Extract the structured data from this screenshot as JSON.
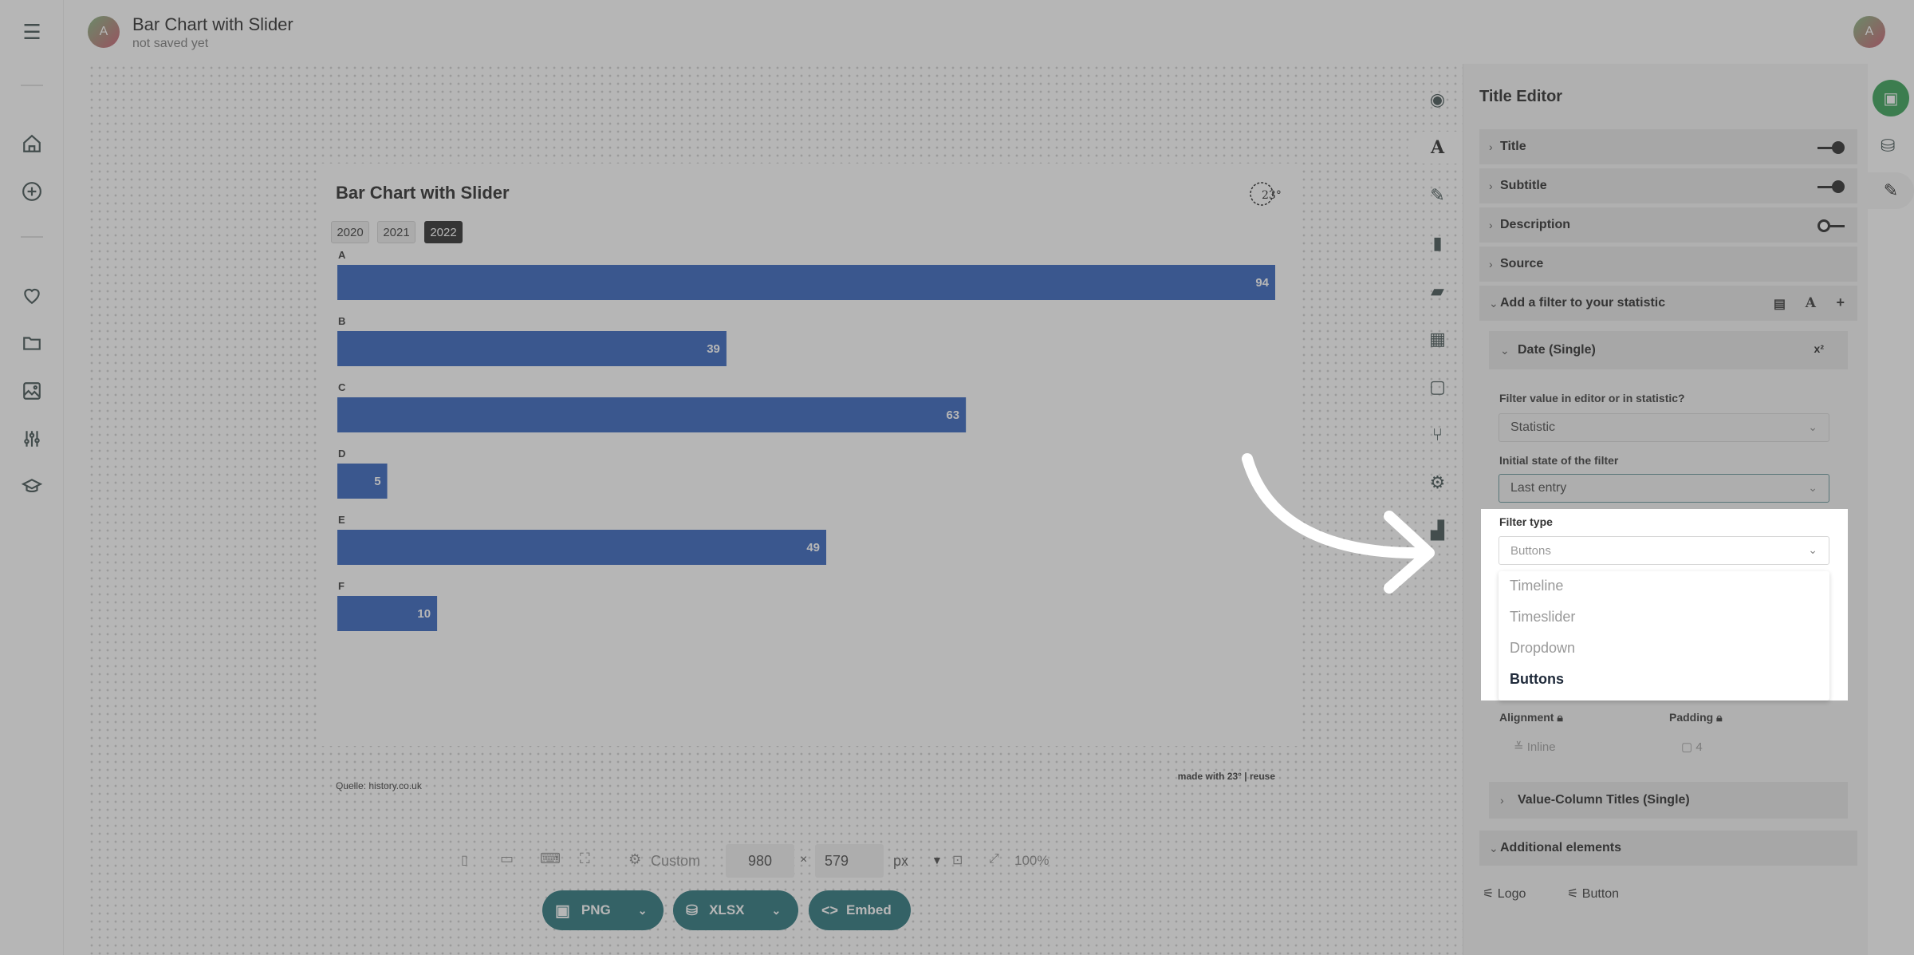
{
  "header": {
    "doc_title": "Bar Chart with Slider",
    "save_status": "not saved yet",
    "avatar_letter": "A",
    "user_avatar_letter": "A"
  },
  "sidebar": {
    "icons": [
      "menu-icon",
      "home-icon",
      "add-circle-icon",
      "heart-icon",
      "folder-icon",
      "image-icon",
      "sliders-icon",
      "graduation-cap-icon"
    ]
  },
  "chart": {
    "title": "Bar Chart with Slider",
    "logo_text": "23°",
    "year_buttons": [
      "2020",
      "2021",
      "2022"
    ],
    "active_year": "2022",
    "source": "Quelle: history.co.uk",
    "footer": "made with 23° | reuse",
    "bar_color": "#2a5cba"
  },
  "chart_data": {
    "type": "bar",
    "orientation": "horizontal",
    "title": "Bar Chart with Slider",
    "categories": [
      "A",
      "B",
      "C",
      "D",
      "E",
      "F"
    ],
    "values": [
      94,
      39,
      63,
      5,
      49,
      10
    ],
    "xlim": [
      0,
      94
    ],
    "grid": false,
    "legend": "none"
  },
  "toolbar": {
    "preset": "Custom",
    "width": "980",
    "times": "×",
    "height": "579",
    "unit": "px",
    "zoom": "100%",
    "png": "PNG",
    "xlsx": "XLSX",
    "embed": "Embed"
  },
  "panel": {
    "title": "Title Editor",
    "rows": {
      "title": "Title",
      "subtitle": "Subtitle",
      "description": "Description",
      "source": "Source",
      "filter": "Add a filter to your statistic",
      "date_single": "Date (Single)",
      "date_superscript": "x²",
      "value_titles": "Value-Column Titles (Single)",
      "additional": "Additional elements"
    },
    "fields": {
      "filter_value_label": "Filter value in editor or in statistic?",
      "filter_value": "Statistic",
      "initial_state_label": "Initial state of the filter",
      "initial_state": "Last entry",
      "filter_type_label": "Filter type",
      "filter_type_placeholder": "Buttons",
      "options": [
        "Timeline",
        "Timeslider",
        "Dropdown",
        "Buttons"
      ],
      "alignment_label": "Alignment",
      "alignment_value": "Inline",
      "padding_label": "Padding",
      "padding_value": "4"
    },
    "additional_items": [
      "Logo",
      "Button"
    ]
  }
}
